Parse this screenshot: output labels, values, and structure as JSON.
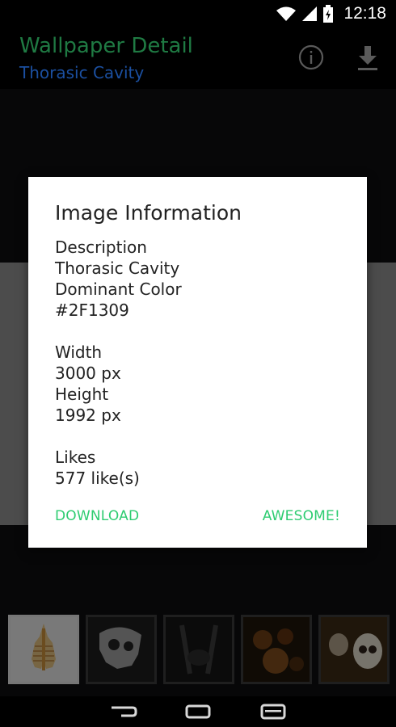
{
  "status": {
    "time": "12:18"
  },
  "appbar": {
    "title": "Wallpaper Detail",
    "subtitle": "Thorasic Cavity"
  },
  "dialog": {
    "title": "Image Information",
    "description_label": "Description",
    "description_value": "Thorasic Cavity",
    "color_label": "Dominant Color",
    "color_value": "#2F1309",
    "width_label": "Width",
    "width_value": "3000 px",
    "height_label": "Height",
    "height_value": "1992 px",
    "likes_label": "Likes",
    "likes_value": "577 like(s)",
    "download_label": "DOWNLOAD",
    "awesome_label": "AWESOME!"
  },
  "colors": {
    "accent_green": "#2ecc71",
    "title_green": "#1f7a43",
    "subtitle_blue": "#1b4fa0"
  },
  "icons": [
    "wifi-icon",
    "signal-icon",
    "battery-icon",
    "info-icon",
    "download-icon",
    "back-icon",
    "home-icon",
    "recents-icon"
  ]
}
